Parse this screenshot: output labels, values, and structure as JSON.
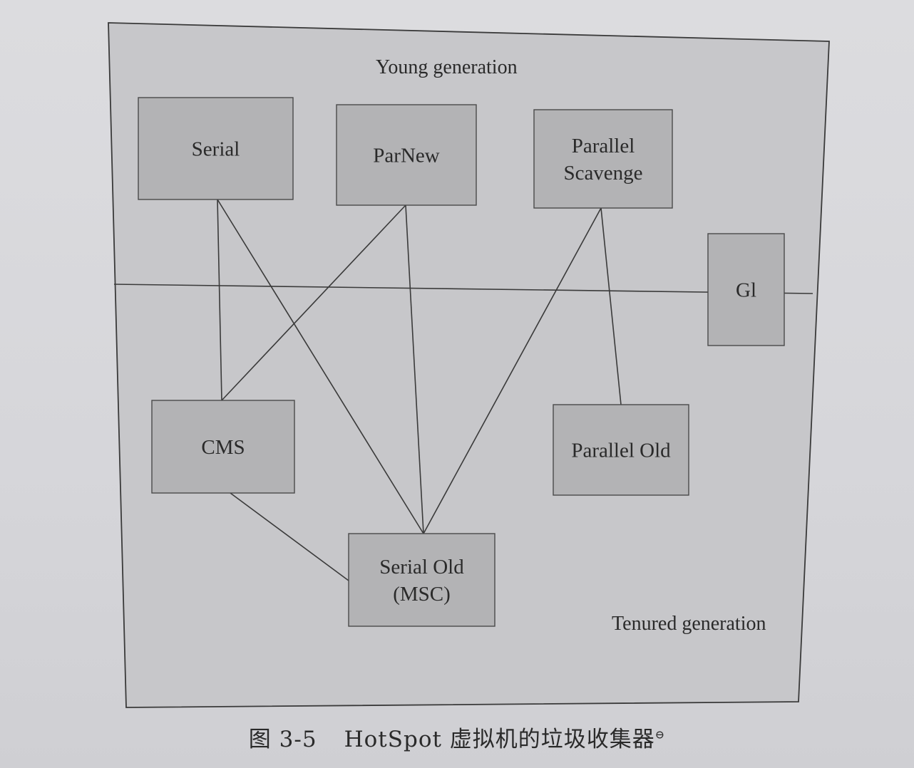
{
  "regions": {
    "young_label": "Young generation",
    "tenured_label": "Tenured generation"
  },
  "collectors": [
    {
      "id": "serial",
      "lines": [
        "Serial"
      ]
    },
    {
      "id": "parnew",
      "lines": [
        "ParNew"
      ]
    },
    {
      "id": "parallel-scavenge",
      "lines": [
        "Parallel",
        "Scavenge"
      ]
    },
    {
      "id": "g1",
      "lines": [
        "Gl"
      ]
    },
    {
      "id": "cms",
      "lines": [
        "CMS"
      ]
    },
    {
      "id": "parallel-old",
      "lines": [
        "Parallel Old"
      ]
    },
    {
      "id": "serial-old",
      "lines": [
        "Serial Old",
        "(MSC)"
      ]
    }
  ],
  "connections": [
    {
      "from": "serial",
      "to": "cms"
    },
    {
      "from": "serial",
      "to": "serial-old"
    },
    {
      "from": "parnew",
      "to": "cms"
    },
    {
      "from": "parnew",
      "to": "serial-old"
    },
    {
      "from": "parallel-scavenge",
      "to": "serial-old"
    },
    {
      "from": "parallel-scavenge",
      "to": "parallel-old"
    },
    {
      "from": "cms",
      "to": "serial-old"
    }
  ],
  "caption": {
    "figure_number": "图 3-5",
    "title": "HotSpot 虚拟机的垃圾收集器",
    "note_mark": "⊖"
  }
}
